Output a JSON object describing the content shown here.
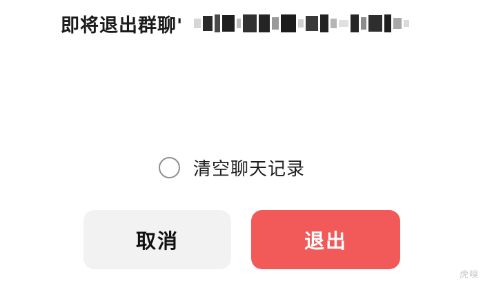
{
  "dialog": {
    "title": "即将退出群聊'",
    "option_label": "清空聊天记录",
    "option_checked": false,
    "cancel_label": "取消",
    "exit_label": "退出",
    "accent_color": "#f25a5a",
    "watermark": "虎嗅"
  }
}
